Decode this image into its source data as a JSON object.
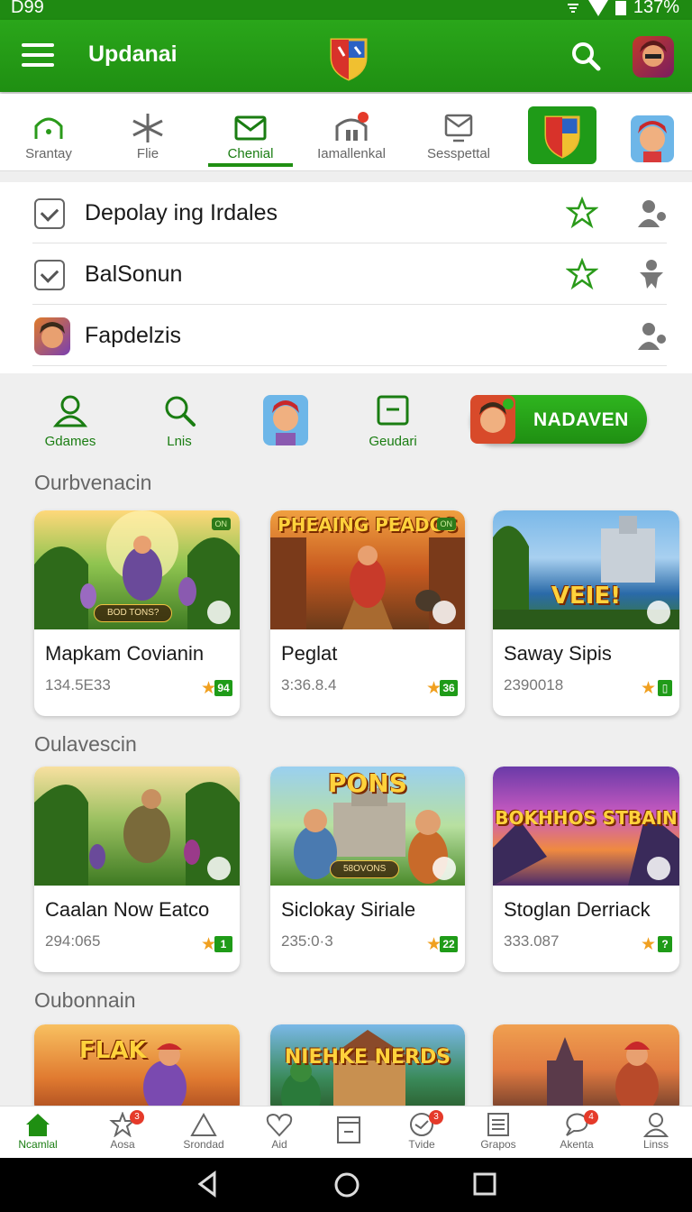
{
  "status": {
    "time": "D99",
    "battery": "137%"
  },
  "appbar": {
    "title": "Updanai"
  },
  "tabs": [
    {
      "label": "Srantay"
    },
    {
      "label": "Flie"
    },
    {
      "label": "Chenial"
    },
    {
      "label": "Iamallenkal"
    },
    {
      "label": "Sesspettal"
    }
  ],
  "list": [
    {
      "text": "Depolay ing Irdales"
    },
    {
      "text": "BalSonun"
    },
    {
      "text": "Fapdelzis"
    }
  ],
  "quick_actions": [
    {
      "label": "Gdames"
    },
    {
      "label": "Lnis"
    },
    {
      "label": "Geudari"
    }
  ],
  "cta": {
    "label": "NADAVEN"
  },
  "sections": [
    {
      "title": "Ourbvenacin",
      "cards": [
        {
          "title": "Mapkam Covianin",
          "stat": "134.5E33",
          "badge": "94",
          "pill": "BOD TONS?",
          "corner": "ON",
          "headline": ""
        },
        {
          "title": "Peglat",
          "stat": "3:36.8.4",
          "badge": "36",
          "pill": "",
          "corner": "ON",
          "headline": "PHEAING PEADOS"
        },
        {
          "title": "Saway Sipis",
          "stat": "2390018",
          "badge": "",
          "pill": "",
          "corner": "",
          "headline": "VEIE!"
        }
      ]
    },
    {
      "title": "Oulavescin",
      "cards": [
        {
          "title": "Caalan Now Eatco",
          "stat": "294:065",
          "badge": "1",
          "pill": "",
          "corner": "",
          "headline": ""
        },
        {
          "title": "Siclokay Siriale",
          "stat": "235:0·3",
          "badge": "22",
          "pill": "58OVONS",
          "corner": "",
          "headline": "PONS"
        },
        {
          "title": "Stoglan Derriack",
          "stat": "333.087",
          "badge": "",
          "pill": "",
          "corner": "",
          "headline": "BOKHHOS STBAIN"
        }
      ]
    },
    {
      "title": "Oubonnain",
      "cards": [
        {
          "headline": "FLAK"
        },
        {
          "headline": "NIEHKE NERDS"
        },
        {
          "headline": ""
        }
      ]
    }
  ],
  "bottom_nav": [
    {
      "label": "Ncamlal",
      "badge": ""
    },
    {
      "label": "Aosa",
      "badge": "3"
    },
    {
      "label": "Srondad",
      "badge": ""
    },
    {
      "label": "Aid",
      "badge": ""
    },
    {
      "label": "",
      "badge": ""
    },
    {
      "label": "Tvide",
      "badge": "3"
    },
    {
      "label": "Grapos",
      "badge": ""
    },
    {
      "label": "Akenta",
      "badge": "4"
    },
    {
      "label": "Linss",
      "badge": ""
    }
  ],
  "colors": {
    "primary": "#1f8f12",
    "accent_star": "#f0a020",
    "badge_red": "#e53a2a"
  }
}
